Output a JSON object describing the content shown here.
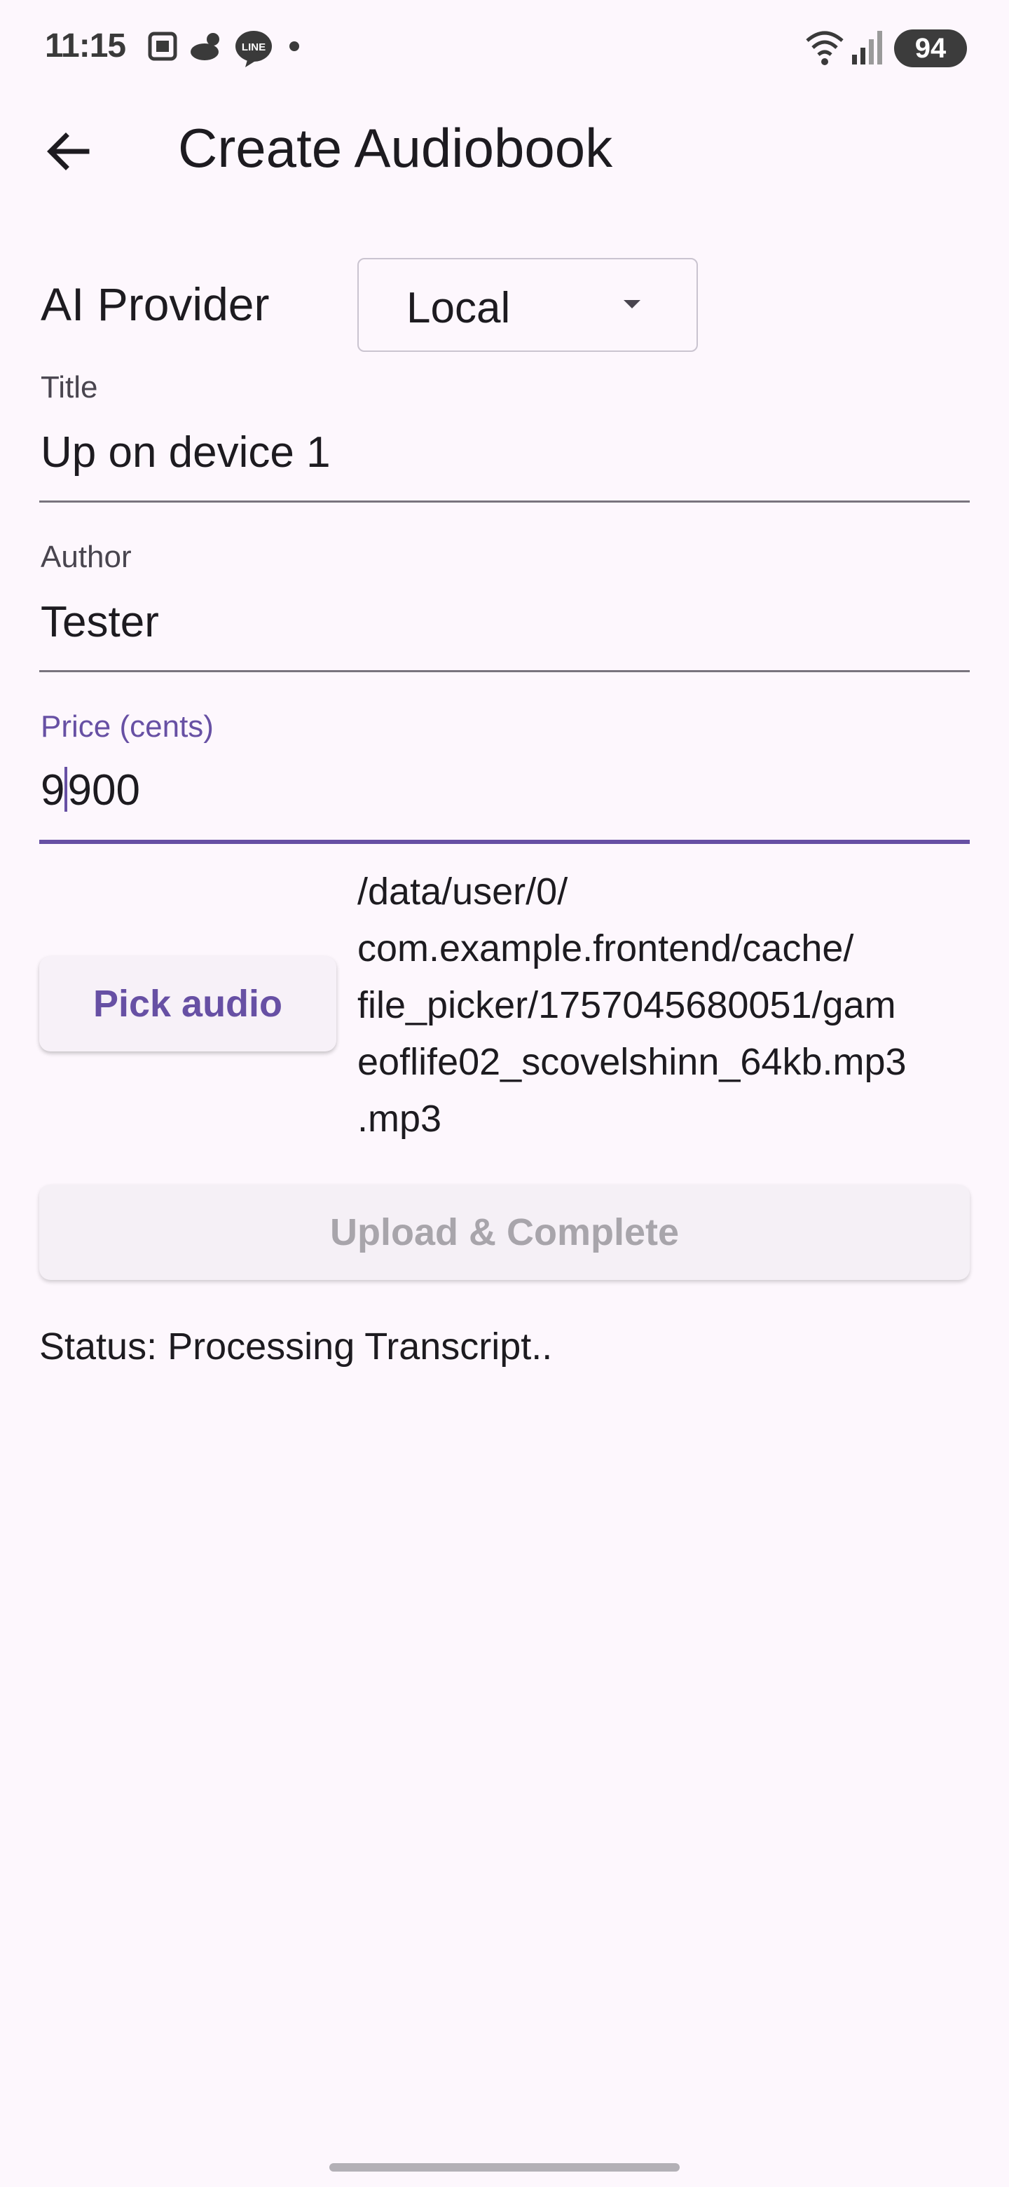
{
  "status_bar": {
    "time": "11:15",
    "battery": "94",
    "icons": [
      "screenshot-icon",
      "weather-icon",
      "line-app-icon",
      "dot-icon",
      "wifi-icon",
      "signal-icon",
      "battery-charging-icon"
    ]
  },
  "app_bar": {
    "title": "Create Audiobook",
    "back_icon": "arrow-back-icon"
  },
  "provider": {
    "label": "AI Provider",
    "selected": "Local",
    "caret_icon": "dropdown-caret-icon"
  },
  "fields": {
    "title": {
      "label": "Title",
      "value": "Up on device 1"
    },
    "author": {
      "label": "Author",
      "value": "Tester"
    },
    "price": {
      "label": "Price (cents)",
      "value_before_cursor": "9",
      "value_after_cursor": "900"
    }
  },
  "pick_audio": {
    "button_label": "Pick audio",
    "file_path": "/data/user/0/\ncom.example.frontend/cache/\nfile_picker/1757045680051/gam\neoflife02_scovelshinn_64kb.mp3\n.mp3"
  },
  "upload": {
    "button_label": "Upload & Complete",
    "enabled": false
  },
  "status": {
    "text": "Status: Processing Transcript.."
  },
  "colors": {
    "background": "#fdf7fd",
    "accent": "#6750a4",
    "text": "#1d1b20",
    "label": "#49454f",
    "disabled_text": "#a8a5ab"
  }
}
